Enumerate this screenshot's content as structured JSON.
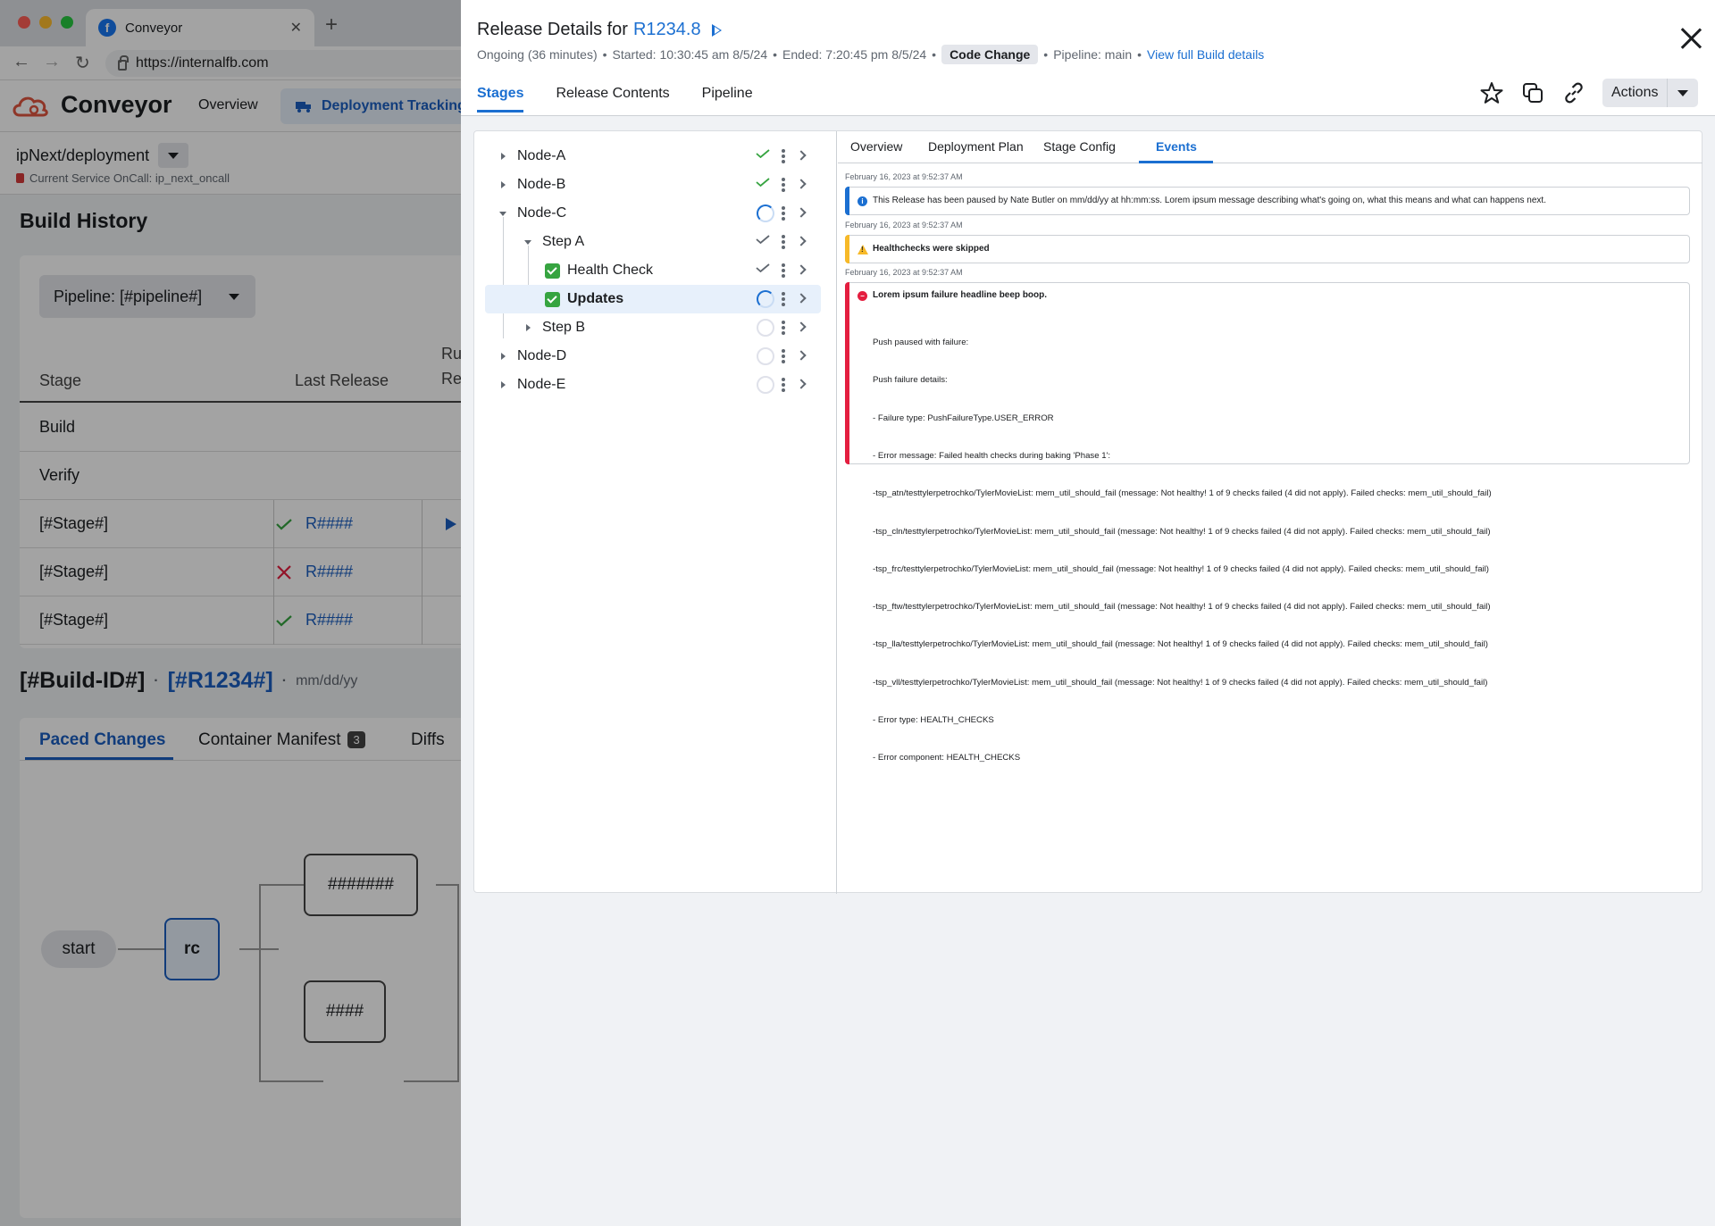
{
  "browser": {
    "tab_title": "Conveyor",
    "url": "https://internalfb.com"
  },
  "app": {
    "name": "Conveyor",
    "nav": {
      "overview": "Overview",
      "deployment_tracking": "Deployment Tracking"
    },
    "service": "ipNext/deployment",
    "oncall": "Current Service OnCall: ip_next_oncall",
    "build_history_title": "Build History",
    "pipeline_filter": "Pipeline: [#pipeline#]",
    "table_headers": {
      "stage": "Stage",
      "last_release": "Last Release",
      "running_line1": "Ru",
      "running_line2": "Re"
    },
    "rows": [
      {
        "stage": "Build"
      },
      {
        "stage": "Verify"
      },
      {
        "stage": "[#Stage#]",
        "status": "success",
        "release": "R####"
      },
      {
        "stage": "[#Stage#]",
        "status": "failed",
        "release": "R####"
      },
      {
        "stage": "[#Stage#]",
        "status": "success",
        "release": "R####"
      }
    ],
    "build_id": "[#Build-ID#]",
    "build_release": "[#R1234#]",
    "build_separator": "·",
    "build_date": "mm/dd/yy",
    "paced_tabs": {
      "paced_changes": "Paced Changes",
      "container_manifest": "Container Manifest",
      "manifest_count": "3",
      "diffs": "Diffs"
    },
    "graph": {
      "start": "start",
      "rc": "rc",
      "node_top": "#######",
      "node_bottom": "####"
    }
  },
  "panel": {
    "title_prefix": "Release Details for",
    "release": "R1234.8",
    "meta": {
      "status": "Ongoing (36 minutes)",
      "started": "Started: 10:30:45 am 8/5/24",
      "ended": "Ended: 7:20:45 pm 8/5/24",
      "chip": "Code Change",
      "pipeline": "Pipeline: main",
      "link": "View full Build details",
      "separator": "•"
    },
    "tabs": {
      "stages": "Stages",
      "release_contents": "Release Contents",
      "pipeline": "Pipeline"
    },
    "actions_label": "Actions",
    "tree": [
      {
        "label": "Node-A",
        "status": "success"
      },
      {
        "label": "Node-B",
        "status": "success"
      },
      {
        "label": "Node-C",
        "status": "running"
      },
      {
        "label": "Step A",
        "status": "done"
      },
      {
        "label": "Health Check",
        "status": "done"
      },
      {
        "label": "Updates",
        "status": "running"
      },
      {
        "label": "Step B",
        "status": "pending"
      },
      {
        "label": "Node-D",
        "status": "pending"
      },
      {
        "label": "Node-E",
        "status": "pending"
      }
    ],
    "event_tabs": {
      "overview": "Overview",
      "deployment_plan": "Deployment Plan",
      "stage_config": "Stage Config",
      "events": "Events"
    },
    "events": [
      {
        "type": "info",
        "timestamp": "February 16, 2023 at 9:52:37 AM",
        "message": "This Release has been paused by Nate Butler on mm/dd/yy at hh:mm:ss. Lorem ipsum message describing what's going on, what this means and what can happens next."
      },
      {
        "type": "warning",
        "timestamp": "February 16, 2023 at 9:52:37 AM",
        "message": "Healthchecks were skipped"
      },
      {
        "type": "error",
        "timestamp": "February 16, 2023 at 9:52:37 AM",
        "headline": "Lorem ipsum failure headline beep boop.",
        "lines": [
          "Push paused with failure:",
          "Push failure details:",
          "- Failure type: PushFailureType.USER_ERROR",
          "- Error message: Failed health checks during baking 'Phase 1':",
          "-tsp_atn/testtylerpetrochko/TylerMovieList: mem_util_should_fail (message: Not healthy! 1 of 9 checks failed (4 did not apply). Failed checks: mem_util_should_fail)",
          "-tsp_cln/testtylerpetrochko/TylerMovieList: mem_util_should_fail (message: Not healthy! 1 of 9 checks failed (4 did not apply). Failed checks: mem_util_should_fail)",
          "-tsp_frc/testtylerpetrochko/TylerMovieList: mem_util_should_fail (message: Not healthy! 1 of 9 checks failed (4 did not apply). Failed checks: mem_util_should_fail)",
          "-tsp_ftw/testtylerpetrochko/TylerMovieList: mem_util_should_fail (message: Not healthy! 1 of 9 checks failed (4 did not apply). Failed checks: mem_util_should_fail)",
          "-tsp_lla/testtylerpetrochko/TylerMovieList: mem_util_should_fail (message: Not healthy! 1 of 9 checks failed (4 did not apply). Failed checks: mem_util_should_fail)",
          "-tsp_vll/testtylerpetrochko/TylerMovieList: mem_util_should_fail (message: Not healthy! 1 of 9 checks failed (4 did not apply). Failed checks: mem_util_should_fail)",
          "- Error type: HEALTH_CHECKS",
          "- Error component: HEALTH_CHECKS"
        ]
      }
    ]
  },
  "colors": {
    "accent": "#1b6fd1",
    "success": "#36a440",
    "error": "#e41e3f",
    "warning": "#f7b928"
  }
}
